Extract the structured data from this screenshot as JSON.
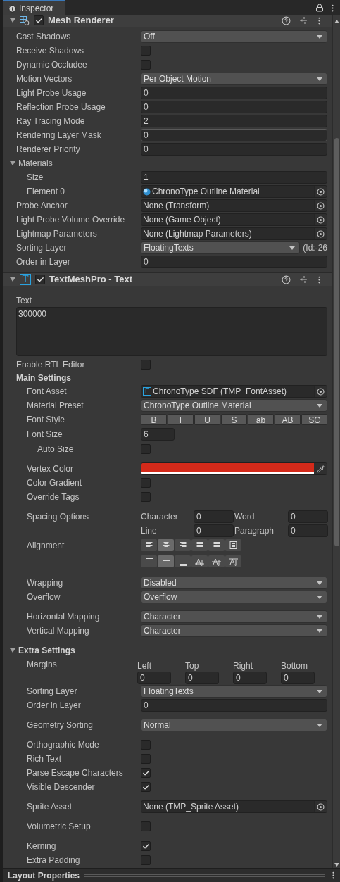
{
  "tab": {
    "title": "Inspector",
    "selected": true
  },
  "components": [
    {
      "title": "Mesh Renderer",
      "enabled": true,
      "expanded": true,
      "rows": [
        {
          "kind": "dropdown",
          "label": "Cast Shadows",
          "value": "Off"
        },
        {
          "kind": "checkbox",
          "label": "Receive Shadows",
          "checked": false
        },
        {
          "kind": "checkbox",
          "label": "Dynamic Occludee",
          "checked": false
        },
        {
          "kind": "dropdown",
          "label": "Motion Vectors",
          "value": "Per Object Motion"
        },
        {
          "kind": "field",
          "label": "Light Probe Usage",
          "value": "0"
        },
        {
          "kind": "field",
          "label": "Reflection Probe Usage",
          "value": "0"
        },
        {
          "kind": "field",
          "label": "Ray Tracing Mode",
          "value": "2"
        },
        {
          "kind": "field",
          "label": "Rendering Layer Mask",
          "value": "0",
          "focused": true
        },
        {
          "kind": "field",
          "label": "Renderer Priority",
          "value": "0"
        },
        {
          "kind": "foldout",
          "label": "Materials",
          "expanded": true,
          "children": [
            {
              "kind": "field",
              "label": "Size",
              "value": "1"
            },
            {
              "kind": "material",
              "label": "Element 0",
              "value": "ChronoType Outline Material"
            }
          ]
        },
        {
          "kind": "object",
          "label": "Probe Anchor",
          "value": "None (Transform)"
        },
        {
          "kind": "object",
          "label": "Light Probe Volume Override",
          "value": "None (Game Object)"
        },
        {
          "kind": "object",
          "label": "Lightmap Parameters",
          "value": "None (Lightmap Parameters)"
        },
        {
          "kind": "dropdown",
          "label": "Sorting Layer",
          "value": "FloatingTexts",
          "suffix": "(Id:-26"
        },
        {
          "kind": "field",
          "label": "Order in Layer",
          "value": "0"
        }
      ]
    },
    {
      "title": "TextMeshPro - Text",
      "icon_letter": "T",
      "enabled": true,
      "expanded": true,
      "rows": [
        {
          "kind": "spacer"
        },
        {
          "kind": "textarea",
          "label": "Text",
          "value": "300000"
        },
        {
          "kind": "checkbox",
          "label": "Enable RTL Editor",
          "checked": false
        },
        {
          "kind": "heading",
          "label": "Main Settings",
          "children": [
            {
              "kind": "fontasset",
              "label": "Font Asset",
              "value": "ChronoType SDF (TMP_FontAsset)",
              "asset_letter": "F"
            },
            {
              "kind": "dropdown",
              "label": "Material Preset",
              "value": "ChronoType Outline Material"
            },
            {
              "kind": "toggles",
              "label": "Font Style",
              "options": [
                {
                  "label": "B",
                  "selected": false
                },
                {
                  "label": "I",
                  "selected": false
                },
                {
                  "label": "U",
                  "selected": false
                },
                {
                  "label": "S",
                  "selected": false
                },
                {
                  "label": "ab",
                  "selected": false
                },
                {
                  "label": "AB",
                  "selected": false
                },
                {
                  "label": "SC",
                  "selected": false
                }
              ]
            },
            {
              "kind": "short-field",
              "label": "Font Size",
              "value": "6",
              "children": [
                {
                  "kind": "checkbox",
                  "label": "Auto Size",
                  "checked": false
                }
              ]
            },
            {
              "kind": "spacer"
            },
            {
              "kind": "color",
              "label": "Vertex Color",
              "color": "#d42a1a"
            },
            {
              "kind": "checkbox",
              "label": "Color Gradient",
              "checked": false
            },
            {
              "kind": "checkbox",
              "label": "Override Tags",
              "checked": false
            },
            {
              "kind": "spacer"
            },
            {
              "kind": "spacing",
              "label": "Spacing Options",
              "fields": [
                {
                  "label": "Character",
                  "value": "0"
                },
                {
                  "label": "Word",
                  "value": "0"
                },
                {
                  "label": "Line",
                  "value": "0"
                },
                {
                  "label": "Paragraph",
                  "value": "0"
                }
              ]
            },
            {
              "kind": "alignment",
              "label": "Alignment",
              "horizontal": [
                {
                  "kind": "left",
                  "selected": false
                },
                {
                  "kind": "center",
                  "selected": true
                },
                {
                  "kind": "right",
                  "selected": false
                },
                {
                  "kind": "justified",
                  "selected": false
                },
                {
                  "kind": "flush",
                  "selected": false
                },
                {
                  "kind": "geometry",
                  "selected": false
                }
              ],
              "vertical": [
                {
                  "kind": "top",
                  "selected": false
                },
                {
                  "kind": "middle",
                  "selected": true
                },
                {
                  "kind": "bottom",
                  "selected": false
                },
                {
                  "kind": "baseline",
                  "selected": false
                },
                {
                  "kind": "midline",
                  "selected": false
                },
                {
                  "kind": "capline",
                  "selected": false
                }
              ]
            },
            {
              "kind": "spacer"
            },
            {
              "kind": "dropdown",
              "label": "Wrapping",
              "value": "Disabled"
            },
            {
              "kind": "dropdown",
              "label": "Overflow",
              "value": "Overflow"
            },
            {
              "kind": "spacer"
            },
            {
              "kind": "dropdown",
              "label": "Horizontal Mapping",
              "value": "Character"
            },
            {
              "kind": "dropdown",
              "label": "Vertical Mapping",
              "value": "Character"
            }
          ]
        },
        {
          "kind": "spacer"
        },
        {
          "kind": "foldout",
          "label": "Extra Settings",
          "expanded": true,
          "children": [
            {
              "kind": "margins",
              "label": "Margins",
              "fields": [
                {
                  "label": "Left",
                  "value": "0"
                },
                {
                  "label": "Top",
                  "value": "0"
                },
                {
                  "label": "Right",
                  "value": "0"
                },
                {
                  "label": "Bottom",
                  "value": "0"
                }
              ]
            },
            {
              "kind": "dropdown",
              "label": "Sorting Layer",
              "value": "FloatingTexts"
            },
            {
              "kind": "field",
              "label": "Order in Layer",
              "value": "0"
            },
            {
              "kind": "spacer"
            },
            {
              "kind": "dropdown",
              "label": "Geometry Sorting",
              "value": "Normal"
            },
            {
              "kind": "spacer"
            },
            {
              "kind": "checkbox",
              "label": "Orthographic Mode",
              "checked": false
            },
            {
              "kind": "checkbox",
              "label": "Rich Text",
              "checked": false
            },
            {
              "kind": "checkbox",
              "label": "Parse Escape Characters",
              "checked": true
            },
            {
              "kind": "checkbox",
              "label": "Visible Descender",
              "checked": true
            },
            {
              "kind": "spacer"
            },
            {
              "kind": "object",
              "label": "Sprite Asset",
              "value": "None (TMP_Sprite Asset)"
            },
            {
              "kind": "spacer"
            },
            {
              "kind": "checkbox",
              "label": "Volumetric Setup",
              "checked": false
            },
            {
              "kind": "spacer"
            },
            {
              "kind": "checkbox",
              "label": "Kerning",
              "checked": true
            },
            {
              "kind": "checkbox",
              "label": "Extra Padding",
              "checked": false
            }
          ]
        }
      ]
    }
  ],
  "bottom_bar": {
    "title": "Layout Properties"
  }
}
